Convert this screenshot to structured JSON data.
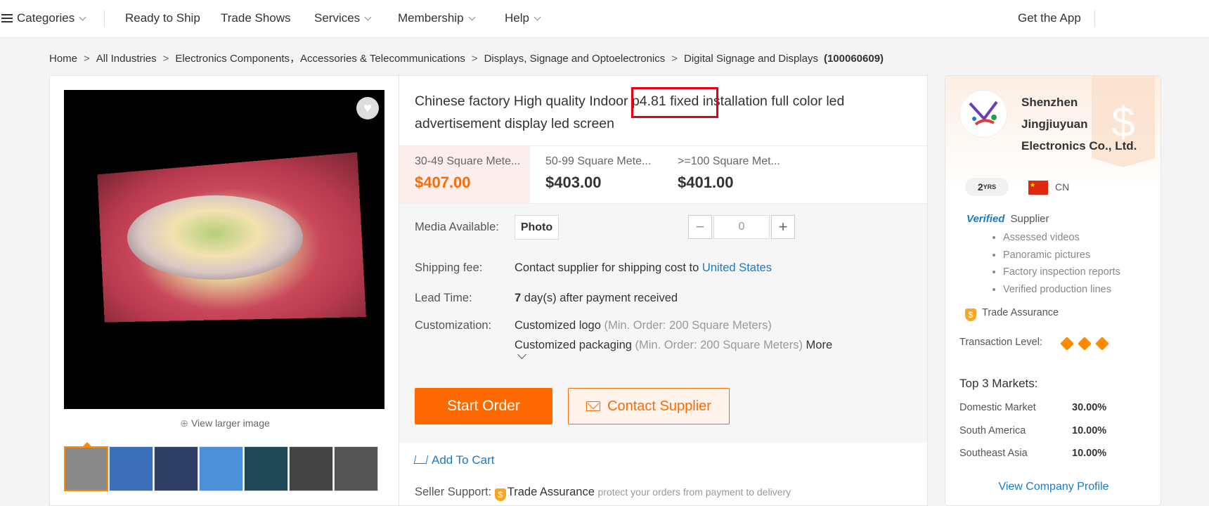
{
  "nav": {
    "categories": "Categories",
    "ready_to_ship": "Ready to Ship",
    "trade_shows": "Trade Shows",
    "services": "Services",
    "membership": "Membership",
    "help": "Help",
    "get_app": "Get the App"
  },
  "breadcrumb": {
    "items": [
      "Home",
      "All Industries",
      "Electronics Components，Accessories & Telecommunications",
      "Displays, Signage and Optoelectronics",
      "Digital Signage and Displays"
    ],
    "category_id": "(100060609)"
  },
  "gallery": {
    "view_larger": "View larger image",
    "thumb_colors": [
      "#8a8a8a",
      "#3a6fb8",
      "#2f3e63",
      "#4a8fd8",
      "#1f4a55",
      "#444444",
      "#555555"
    ]
  },
  "product": {
    "title": "Chinese factory High quality Indoor p4.81 fixed installation full color led advertisement display led screen",
    "price_tiers": [
      {
        "range": "30-49 Square Mete...",
        "price": "$407.00"
      },
      {
        "range": "50-99 Square Mete...",
        "price": "$403.00"
      },
      {
        "range": ">=100 Square Met...",
        "price": "$401.00"
      }
    ],
    "media_label": "Media Available:",
    "media_photo": "Photo",
    "qty_minus": "−",
    "qty_value": "0",
    "qty_plus": "+",
    "shipping_label": "Shipping fee:",
    "shipping_text": "Contact supplier for shipping cost to",
    "shipping_country": "United States",
    "lead_label": "Lead Time:",
    "lead_days": "7",
    "lead_text": "day(s) after payment received",
    "custom_label": "Customization:",
    "custom_logo": "Customized logo",
    "custom_logo_min": "(Min. Order: 200 Square Meters)",
    "custom_pack": "Customized packaging",
    "custom_pack_min": "(Min. Order: 200 Square Meters)",
    "more": "More",
    "start_order": "Start Order",
    "contact_supplier": "Contact Supplier",
    "add_to_cart": "Add To Cart",
    "seller_support_label": "Seller Support:",
    "trade_assurance": "Trade Assurance",
    "ta_note": "protect your orders from payment to delivery"
  },
  "supplier": {
    "name": "Shenzhen Jingjiuyuan Electronics Co., Ltd.",
    "years_num": "2",
    "years_unit": "YRS",
    "country": "CN",
    "verified_logo": "Verified",
    "verified_label": "Supplier",
    "verified_items": [
      "Assessed videos",
      "Panoramic pictures",
      "Factory inspection reports",
      "Verified production lines"
    ],
    "trade_assurance": "Trade Assurance",
    "transaction_level_label": "Transaction Level:",
    "transaction_level": 3,
    "top_markets_title": "Top 3 Markets:",
    "markets": [
      {
        "name": "Domestic Market",
        "pct": "30.00%"
      },
      {
        "name": "South America",
        "pct": "10.00%"
      },
      {
        "name": "Southeast Asia",
        "pct": "10.00%"
      }
    ],
    "view_profile": "View Company Profile"
  }
}
